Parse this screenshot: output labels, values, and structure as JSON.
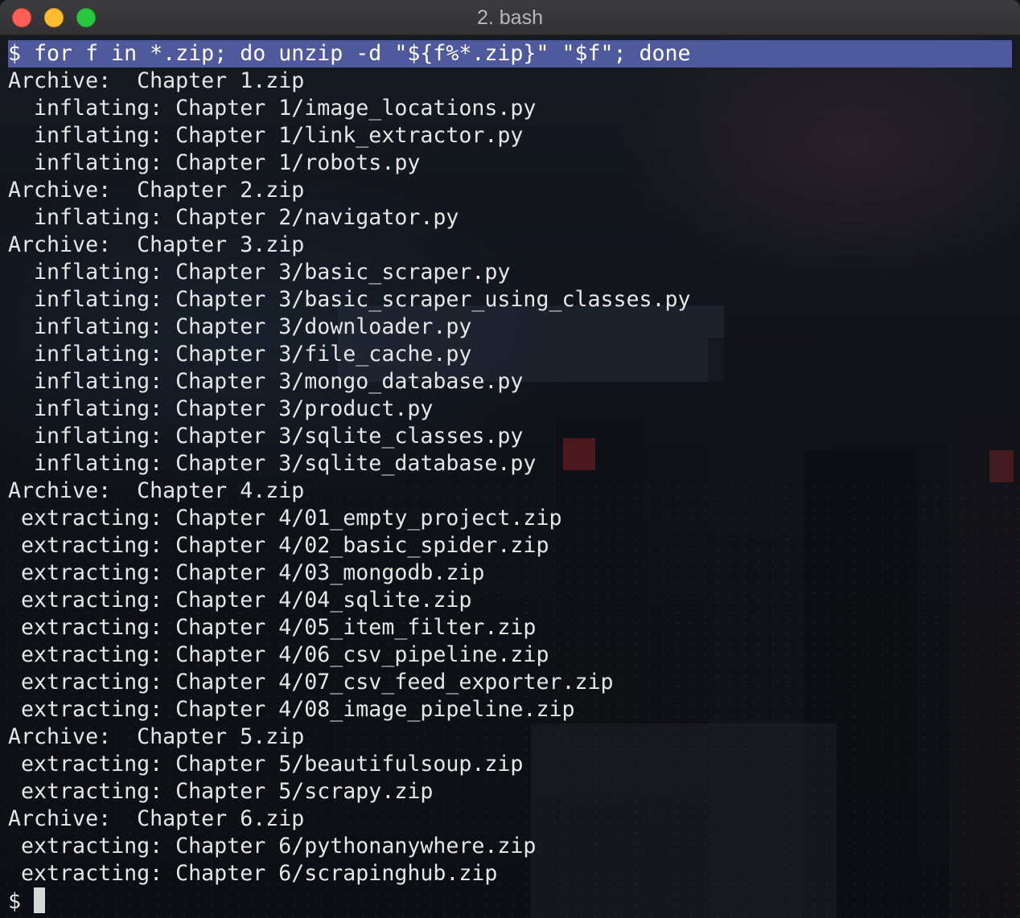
{
  "window": {
    "title": "2. bash"
  },
  "terminal": {
    "command_line": "$ for f in *.zip; do unzip -d \"${f%*.zip}\" \"$f\"; done",
    "output_lines": [
      "Archive:  Chapter 1.zip",
      "  inflating: Chapter 1/image_locations.py",
      "  inflating: Chapter 1/link_extractor.py",
      "  inflating: Chapter 1/robots.py",
      "Archive:  Chapter 2.zip",
      "  inflating: Chapter 2/navigator.py",
      "Archive:  Chapter 3.zip",
      "  inflating: Chapter 3/basic_scraper.py",
      "  inflating: Chapter 3/basic_scraper_using_classes.py",
      "  inflating: Chapter 3/downloader.py",
      "  inflating: Chapter 3/file_cache.py",
      "  inflating: Chapter 3/mongo_database.py",
      "  inflating: Chapter 3/product.py",
      "  inflating: Chapter 3/sqlite_classes.py",
      "  inflating: Chapter 3/sqlite_database.py",
      "Archive:  Chapter 4.zip",
      " extracting: Chapter 4/01_empty_project.zip",
      " extracting: Chapter 4/02_basic_spider.zip",
      " extracting: Chapter 4/03_mongodb.zip",
      " extracting: Chapter 4/04_sqlite.zip",
      " extracting: Chapter 4/05_item_filter.zip",
      " extracting: Chapter 4/06_csv_pipeline.zip",
      " extracting: Chapter 4/07_csv_feed_exporter.zip",
      " extracting: Chapter 4/08_image_pipeline.zip",
      "Archive:  Chapter 5.zip",
      " extracting: Chapter 5/beautifulsoup.zip",
      " extracting: Chapter 5/scrapy.zip",
      "Archive:  Chapter 6.zip",
      " extracting: Chapter 6/pythonanywhere.zip",
      " extracting: Chapter 6/scrapinghub.zip"
    ],
    "prompt": "$ "
  }
}
